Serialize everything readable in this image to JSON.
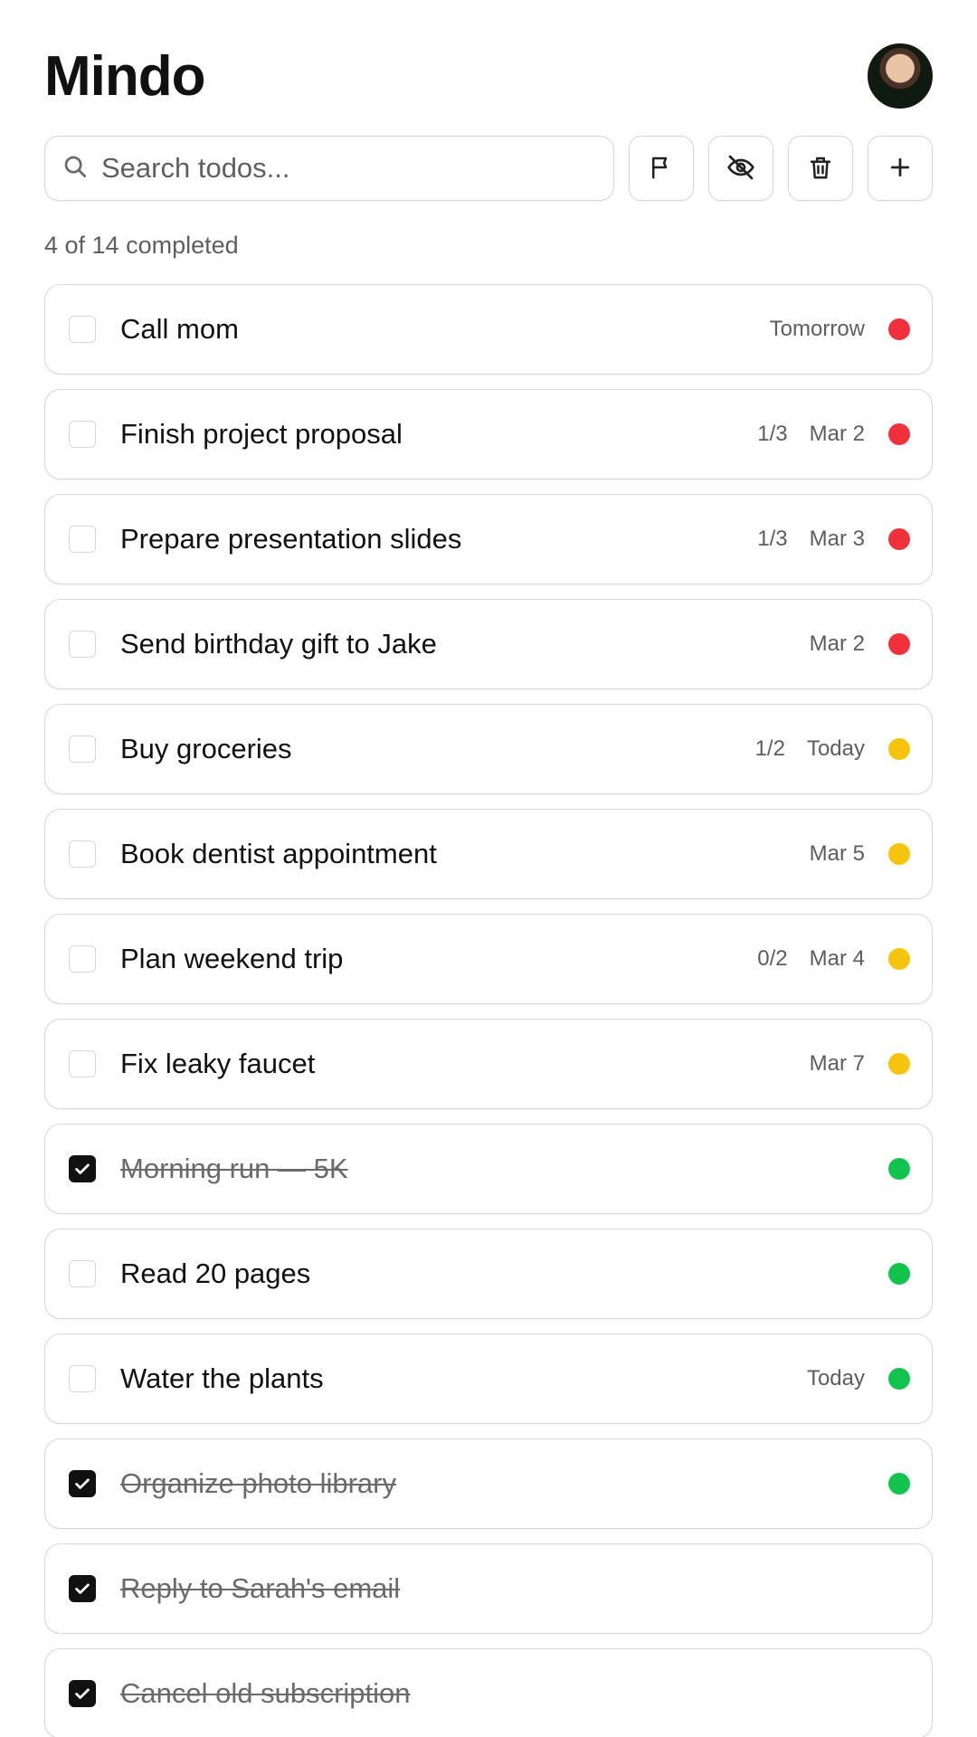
{
  "header": {
    "title": "Mindo"
  },
  "search": {
    "placeholder": "Search todos..."
  },
  "toolbar": {
    "buttons": [
      {
        "name": "filter-flag-button",
        "icon": "flag-icon"
      },
      {
        "name": "hide-completed-button",
        "icon": "eye-off-icon"
      },
      {
        "name": "delete-button",
        "icon": "trash-icon"
      },
      {
        "name": "add-todo-button",
        "icon": "plus-icon"
      }
    ]
  },
  "status": {
    "text": "4 of 14 completed"
  },
  "priority_colors": {
    "high": "#f0303a",
    "medium": "#f6c40c",
    "low": "#12c44e"
  },
  "todos": [
    {
      "title": "Call mom",
      "completed": false,
      "subtasks": "",
      "due": "Tomorrow",
      "priority": "high"
    },
    {
      "title": "Finish project proposal",
      "completed": false,
      "subtasks": "1/3",
      "due": "Mar 2",
      "priority": "high"
    },
    {
      "title": "Prepare presentation slides",
      "completed": false,
      "subtasks": "1/3",
      "due": "Mar 3",
      "priority": "high"
    },
    {
      "title": "Send birthday gift to Jake",
      "completed": false,
      "subtasks": "",
      "due": "Mar 2",
      "priority": "high"
    },
    {
      "title": "Buy groceries",
      "completed": false,
      "subtasks": "1/2",
      "due": "Today",
      "priority": "medium"
    },
    {
      "title": "Book dentist appointment",
      "completed": false,
      "subtasks": "",
      "due": "Mar 5",
      "priority": "medium"
    },
    {
      "title": "Plan weekend trip",
      "completed": false,
      "subtasks": "0/2",
      "due": "Mar 4",
      "priority": "medium"
    },
    {
      "title": "Fix leaky faucet",
      "completed": false,
      "subtasks": "",
      "due": "Mar 7",
      "priority": "medium"
    },
    {
      "title": "Morning run — 5K",
      "completed": true,
      "subtasks": "",
      "due": "",
      "priority": "low"
    },
    {
      "title": "Read 20 pages",
      "completed": false,
      "subtasks": "",
      "due": "",
      "priority": "low"
    },
    {
      "title": "Water the plants",
      "completed": false,
      "subtasks": "",
      "due": "Today",
      "priority": "low"
    },
    {
      "title": "Organize photo library",
      "completed": true,
      "subtasks": "",
      "due": "",
      "priority": "low"
    },
    {
      "title": "Reply to Sarah's email",
      "completed": true,
      "subtasks": "",
      "due": "",
      "priority": ""
    },
    {
      "title": "Cancel old subscription",
      "completed": true,
      "subtasks": "",
      "due": "",
      "priority": ""
    }
  ]
}
